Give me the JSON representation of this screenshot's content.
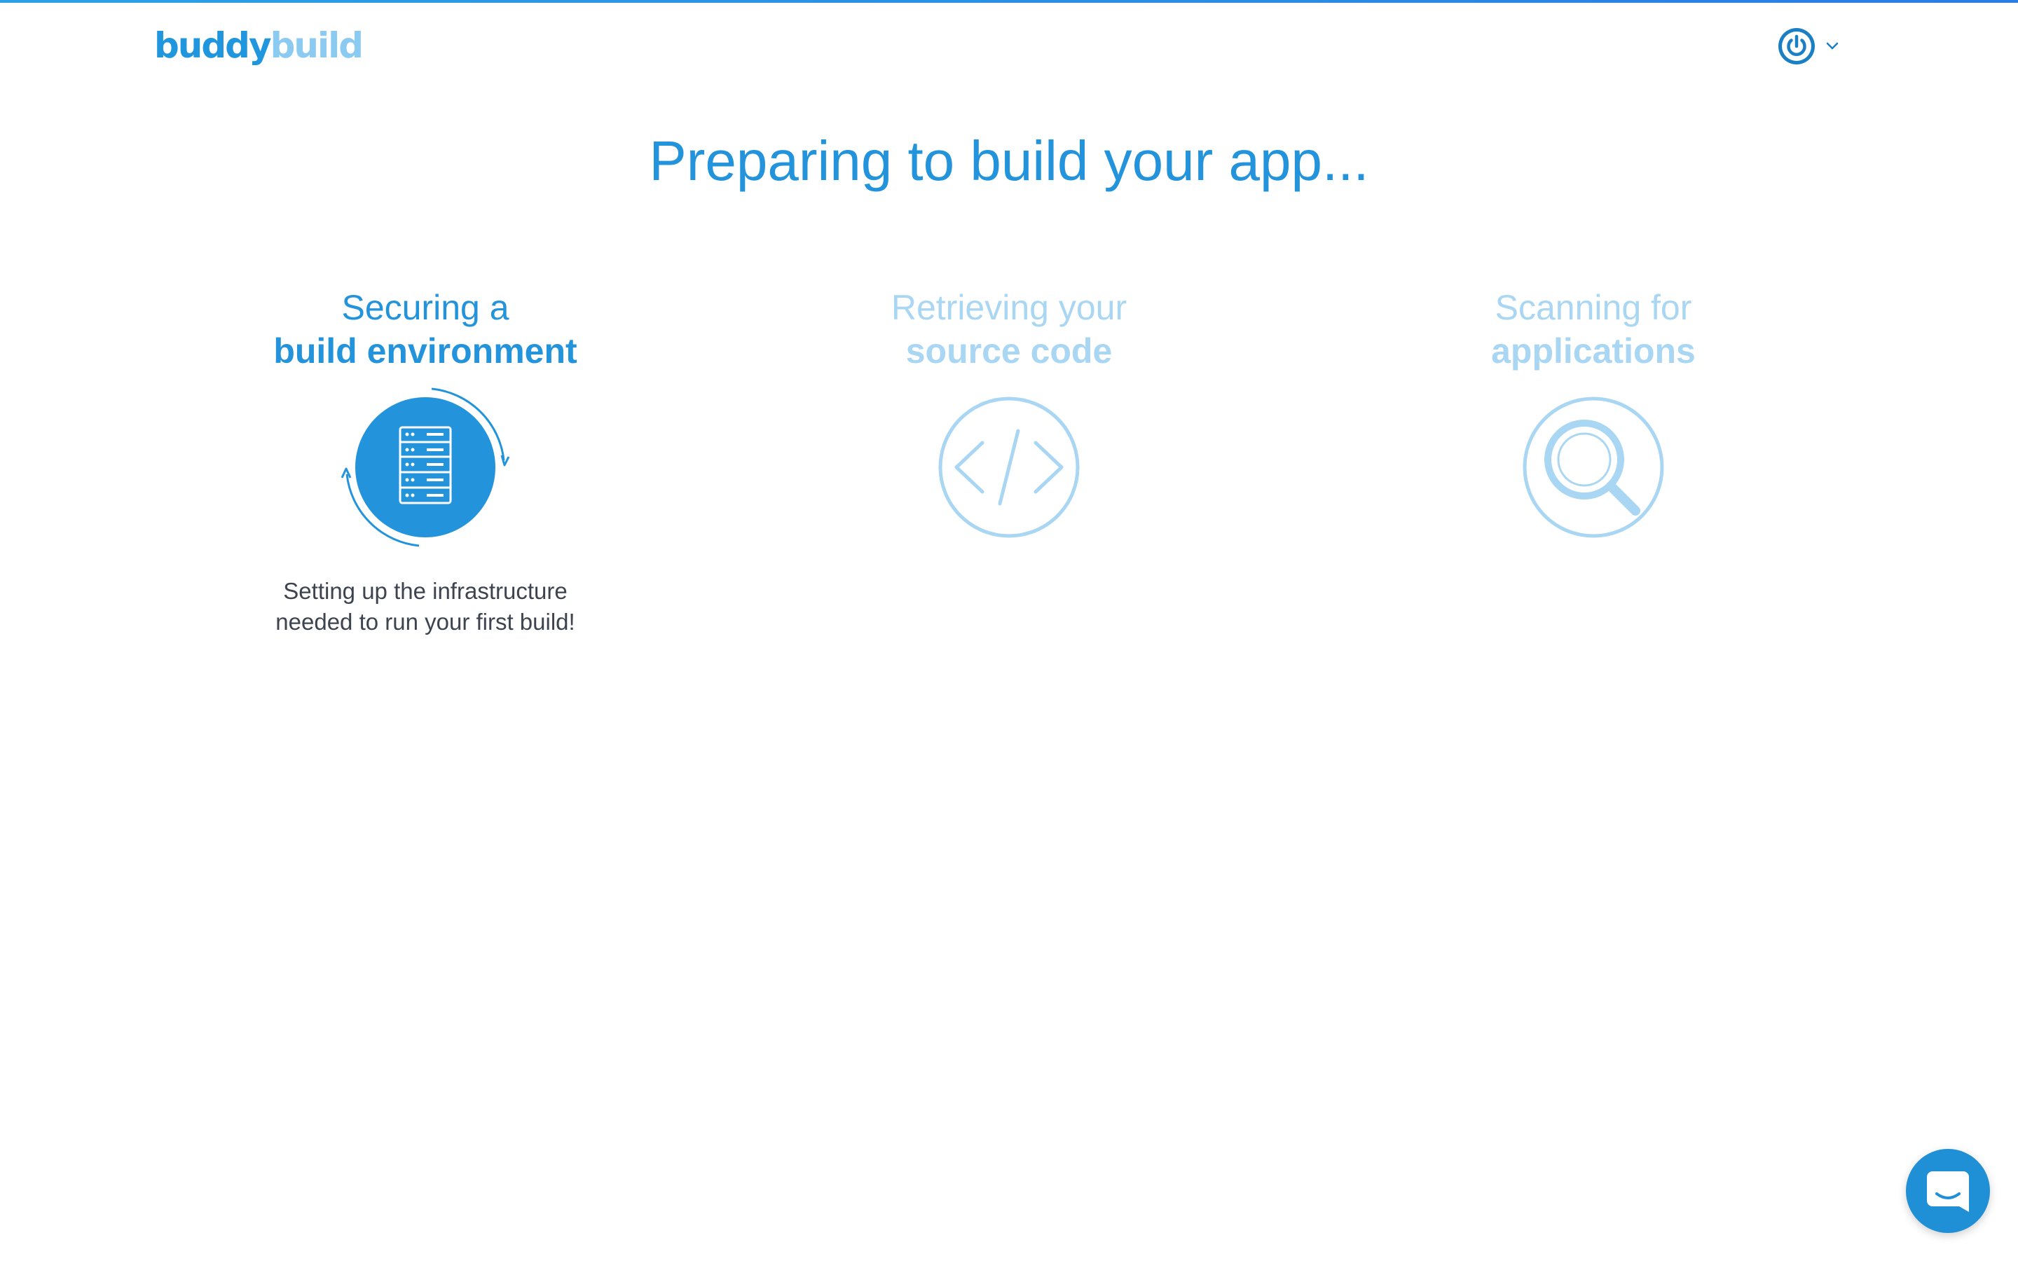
{
  "header": {
    "logo": {
      "part1": "buddy",
      "part2": "build"
    },
    "user_menu_icon": "power-icon",
    "dropdown_icon": "chevron-down-icon"
  },
  "headline": "Preparing to build your app...",
  "steps": [
    {
      "line1": "Securing a",
      "line2": "build environment",
      "icon": "server-rack-icon",
      "state": "active",
      "description_line1": "Setting up the infrastructure",
      "description_line2": "needed to run your first build!"
    },
    {
      "line1": "Retrieving your",
      "line2": "source code",
      "icon": "code-brackets-icon",
      "state": "pending"
    },
    {
      "line1": "Scanning for",
      "line2": "applications",
      "icon": "magnifier-icon",
      "state": "pending"
    }
  ],
  "chat": {
    "icon": "chat-bubble-icon"
  },
  "colors": {
    "primary": "#2394dc",
    "primary_dark": "#1f8fd6",
    "muted": "#a9d6f3",
    "text": "#3d4450"
  }
}
